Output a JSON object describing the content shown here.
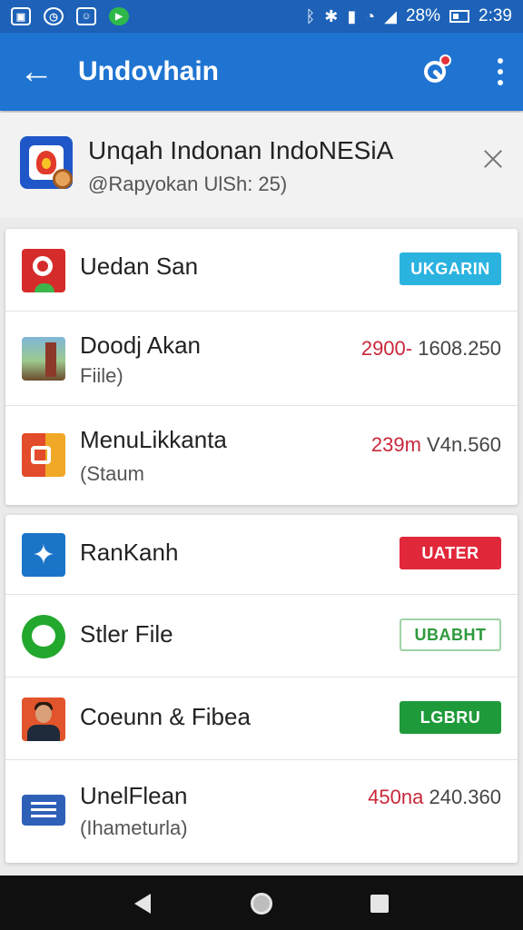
{
  "status_bar": {
    "battery": "28%",
    "time": "2:39",
    "icons": [
      "gallery-icon",
      "clock-icon",
      "photo-icon",
      "play-icon",
      "bluetooth-icon",
      "vibrate-icon",
      "nfc-icon",
      "wifi-icon",
      "signal-icon",
      "battery-icon"
    ]
  },
  "app_bar": {
    "title": "Undovhain",
    "back_icon": "←",
    "actions": [
      "search-icon",
      "more-vert-icon"
    ]
  },
  "header": {
    "title": "Unqah Indonan IndoNESiA",
    "subtitle": "@Rapyokan UlSh: 25)"
  },
  "group1": [
    {
      "title": "Uedan San",
      "pill": "UKGARIN",
      "icon": "red-app-icon"
    },
    {
      "title": "Doodj Akan",
      "subtitle": "Fiile)",
      "price_a": "2900-",
      "price_b": "1608.250",
      "icon": "photo-thumbnail-icon"
    },
    {
      "title": "MenuLikkanta",
      "subtitle": "(Staum",
      "price_a": "239m",
      "price_b": "V4n.560",
      "icon": "orange-app-icon"
    }
  ],
  "group2": [
    {
      "title": "RanKanh",
      "pill": "UATER",
      "icon": "twitter-icon"
    },
    {
      "title": "Stler File",
      "pill": "UBABHT",
      "icon": "chat-icon"
    },
    {
      "title": "Coeunn & Fibea",
      "pill": "LGBRU",
      "icon": "person-avatar-icon"
    },
    {
      "title": "UnelFlean",
      "subtitle": "(Ihameturla)",
      "price_a": "450na",
      "price_b": "240.360",
      "icon": "document-icon"
    }
  ],
  "colors": {
    "app_bar": "#1f74d2",
    "status_bar": "#1d62b8",
    "pill_blue": "#2bb3e0",
    "pill_red": "#e0283a",
    "pill_green_outline": "#2e9a3c",
    "pill_green": "#1f9a3a",
    "price_red": "#c9283a"
  }
}
